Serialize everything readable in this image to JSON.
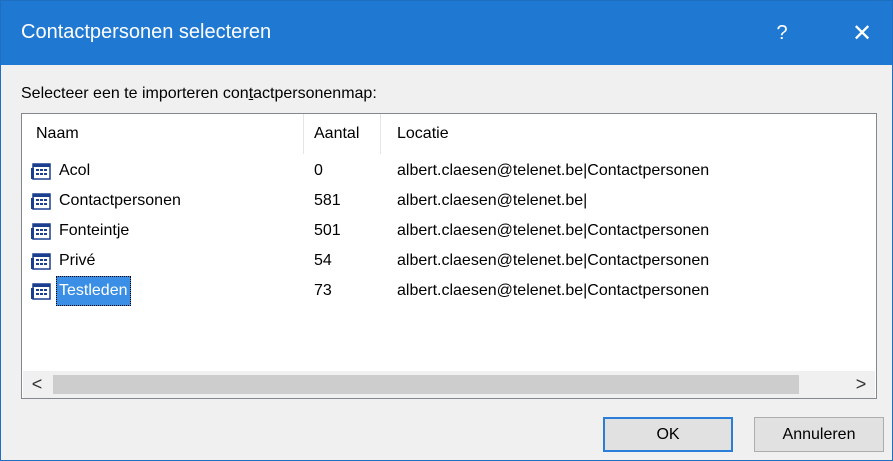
{
  "window": {
    "title": "Contactpersonen selecteren",
    "help": "?",
    "close": "✕"
  },
  "instruction": {
    "before": "Selecteer een te importeren con",
    "accel": "t",
    "after": "actpersonenmap:"
  },
  "columns": {
    "name": "Naam",
    "count": "Aantal",
    "location": "Locatie"
  },
  "rows": [
    {
      "name": "Acol",
      "count": "0",
      "location": "albert.claesen@telenet.be|Contactpersonen"
    },
    {
      "name": "Contactpersonen",
      "count": "581",
      "location": "albert.claesen@telenet.be|"
    },
    {
      "name": "Fonteintje",
      "count": "501",
      "location": "albert.claesen@telenet.be|Contactpersonen"
    },
    {
      "name": "Privé",
      "count": "54",
      "location": "albert.claesen@telenet.be|Contactpersonen"
    },
    {
      "name": "Testleden",
      "count": "73",
      "location": "albert.claesen@telenet.be|Contactpersonen"
    }
  ],
  "selected_row": "Testleden",
  "scrollbar": {
    "left": "<",
    "right": ">"
  },
  "buttons": {
    "ok": "OK",
    "cancel": "Annuleren"
  },
  "colors": {
    "titlebar": "#1f79d2",
    "selection": "#3a8ee6"
  },
  "row_icon": "contact-folder-icon"
}
